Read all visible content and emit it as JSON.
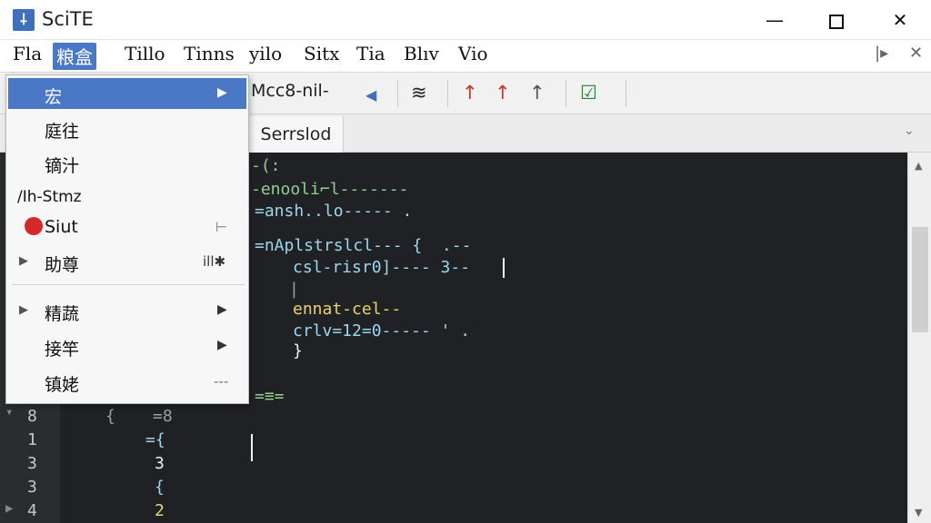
{
  "window": {
    "title": "SciTE",
    "app_icon": "scite-icon",
    "minimize_glyph": "—",
    "close_glyph": "✕"
  },
  "menubar": {
    "items": [
      "Fla",
      "粮盒",
      "Tillo",
      "Tinns",
      "yilo",
      "Sitx",
      "Tia",
      "Blıv",
      "Vio"
    ],
    "right_icons": [
      "|▸",
      "✕"
    ]
  },
  "toolbar": {
    "text": "Mcc8-nil-",
    "icons": [
      "◀",
      "≋",
      "↑",
      "↑",
      "↑",
      "☑"
    ]
  },
  "tabbar": {
    "tab_label": "Serrslod",
    "chevron": "⌄"
  },
  "dropdown": {
    "items": [
      {
        "label": "宏",
        "arrow": "▶",
        "highlight": true
      },
      {
        "label": "庭往"
      },
      {
        "label": "镝汁"
      },
      {
        "label": "/Ih-Stmz"
      },
      {
        "label": "Siut",
        "short": "⊢"
      },
      {
        "label": "助尊",
        "lead": "▶",
        "short": "ill✱"
      },
      {
        "label": "精蔬",
        "lead": "▶",
        "arrow": "▶"
      },
      {
        "label": "接竿",
        "arrow": "▶"
      },
      {
        "label": "镇姥",
        "short": "---"
      }
    ]
  },
  "editor": {
    "line_numbers": [
      "8",
      "1",
      "3",
      "3",
      "4"
    ],
    "lines": [
      {
        "text": "-(:",
        "color": "green"
      },
      {
        "text": "-enooli⌐l-------",
        "color": "green"
      },
      {
        "text": "=ansh..lo----- .",
        "color": "cyan"
      },
      {
        "text": "=nAplstrslcl--- {  .--",
        "color": "cyan"
      },
      {
        "text": "csl-risr0]---- 3--",
        "color": "cyan"
      },
      {
        "text": "|",
        "color": "dim"
      },
      {
        "text": "ennat-cel--",
        "color": "yellow"
      },
      {
        "text": "crlv=12=0----- ' .",
        "color": "cyan"
      },
      {
        "text": "}",
        "color": "white"
      },
      {
        "text": "=≡=",
        "color": "green"
      }
    ],
    "left_fragments": [
      "=8",
      "{",
      "={",
      "3",
      "{",
      "2"
    ],
    "gutter_fold_icons": [
      "▾",
      "▶"
    ]
  },
  "colors": {
    "accent": "#4a78c6",
    "editor_bg": "#202124",
    "breakpoint": "#d62828"
  }
}
